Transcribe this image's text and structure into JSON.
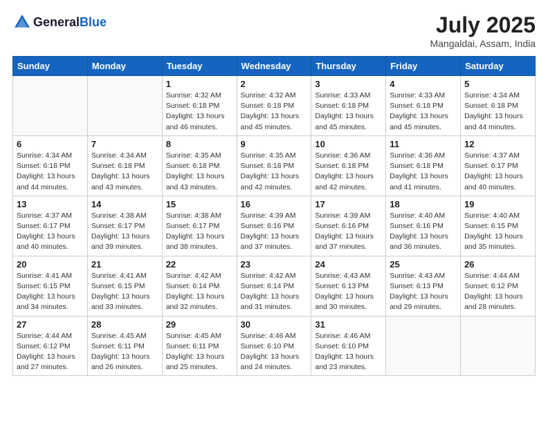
{
  "header": {
    "logo_general": "General",
    "logo_blue": "Blue",
    "month_year": "July 2025",
    "location": "Mangaldai, Assam, India"
  },
  "weekdays": [
    "Sunday",
    "Monday",
    "Tuesday",
    "Wednesday",
    "Thursday",
    "Friday",
    "Saturday"
  ],
  "weeks": [
    [
      {
        "day": "",
        "info": ""
      },
      {
        "day": "",
        "info": ""
      },
      {
        "day": "1",
        "info": "Sunrise: 4:32 AM\nSunset: 6:18 PM\nDaylight: 13 hours and 46 minutes."
      },
      {
        "day": "2",
        "info": "Sunrise: 4:32 AM\nSunset: 6:18 PM\nDaylight: 13 hours and 45 minutes."
      },
      {
        "day": "3",
        "info": "Sunrise: 4:33 AM\nSunset: 6:18 PM\nDaylight: 13 hours and 45 minutes."
      },
      {
        "day": "4",
        "info": "Sunrise: 4:33 AM\nSunset: 6:18 PM\nDaylight: 13 hours and 45 minutes."
      },
      {
        "day": "5",
        "info": "Sunrise: 4:34 AM\nSunset: 6:18 PM\nDaylight: 13 hours and 44 minutes."
      }
    ],
    [
      {
        "day": "6",
        "info": "Sunrise: 4:34 AM\nSunset: 6:18 PM\nDaylight: 13 hours and 44 minutes."
      },
      {
        "day": "7",
        "info": "Sunrise: 4:34 AM\nSunset: 6:18 PM\nDaylight: 13 hours and 43 minutes."
      },
      {
        "day": "8",
        "info": "Sunrise: 4:35 AM\nSunset: 6:18 PM\nDaylight: 13 hours and 43 minutes."
      },
      {
        "day": "9",
        "info": "Sunrise: 4:35 AM\nSunset: 6:18 PM\nDaylight: 13 hours and 42 minutes."
      },
      {
        "day": "10",
        "info": "Sunrise: 4:36 AM\nSunset: 6:18 PM\nDaylight: 13 hours and 42 minutes."
      },
      {
        "day": "11",
        "info": "Sunrise: 4:36 AM\nSunset: 6:18 PM\nDaylight: 13 hours and 41 minutes."
      },
      {
        "day": "12",
        "info": "Sunrise: 4:37 AM\nSunset: 6:17 PM\nDaylight: 13 hours and 40 minutes."
      }
    ],
    [
      {
        "day": "13",
        "info": "Sunrise: 4:37 AM\nSunset: 6:17 PM\nDaylight: 13 hours and 40 minutes."
      },
      {
        "day": "14",
        "info": "Sunrise: 4:38 AM\nSunset: 6:17 PM\nDaylight: 13 hours and 39 minutes."
      },
      {
        "day": "15",
        "info": "Sunrise: 4:38 AM\nSunset: 6:17 PM\nDaylight: 13 hours and 38 minutes."
      },
      {
        "day": "16",
        "info": "Sunrise: 4:39 AM\nSunset: 6:16 PM\nDaylight: 13 hours and 37 minutes."
      },
      {
        "day": "17",
        "info": "Sunrise: 4:39 AM\nSunset: 6:16 PM\nDaylight: 13 hours and 37 minutes."
      },
      {
        "day": "18",
        "info": "Sunrise: 4:40 AM\nSunset: 6:16 PM\nDaylight: 13 hours and 36 minutes."
      },
      {
        "day": "19",
        "info": "Sunrise: 4:40 AM\nSunset: 6:15 PM\nDaylight: 13 hours and 35 minutes."
      }
    ],
    [
      {
        "day": "20",
        "info": "Sunrise: 4:41 AM\nSunset: 6:15 PM\nDaylight: 13 hours and 34 minutes."
      },
      {
        "day": "21",
        "info": "Sunrise: 4:41 AM\nSunset: 6:15 PM\nDaylight: 13 hours and 33 minutes."
      },
      {
        "day": "22",
        "info": "Sunrise: 4:42 AM\nSunset: 6:14 PM\nDaylight: 13 hours and 32 minutes."
      },
      {
        "day": "23",
        "info": "Sunrise: 4:42 AM\nSunset: 6:14 PM\nDaylight: 13 hours and 31 minutes."
      },
      {
        "day": "24",
        "info": "Sunrise: 4:43 AM\nSunset: 6:13 PM\nDaylight: 13 hours and 30 minutes."
      },
      {
        "day": "25",
        "info": "Sunrise: 4:43 AM\nSunset: 6:13 PM\nDaylight: 13 hours and 29 minutes."
      },
      {
        "day": "26",
        "info": "Sunrise: 4:44 AM\nSunset: 6:12 PM\nDaylight: 13 hours and 28 minutes."
      }
    ],
    [
      {
        "day": "27",
        "info": "Sunrise: 4:44 AM\nSunset: 6:12 PM\nDaylight: 13 hours and 27 minutes."
      },
      {
        "day": "28",
        "info": "Sunrise: 4:45 AM\nSunset: 6:11 PM\nDaylight: 13 hours and 26 minutes."
      },
      {
        "day": "29",
        "info": "Sunrise: 4:45 AM\nSunset: 6:11 PM\nDaylight: 13 hours and 25 minutes."
      },
      {
        "day": "30",
        "info": "Sunrise: 4:46 AM\nSunset: 6:10 PM\nDaylight: 13 hours and 24 minutes."
      },
      {
        "day": "31",
        "info": "Sunrise: 4:46 AM\nSunset: 6:10 PM\nDaylight: 13 hours and 23 minutes."
      },
      {
        "day": "",
        "info": ""
      },
      {
        "day": "",
        "info": ""
      }
    ]
  ]
}
